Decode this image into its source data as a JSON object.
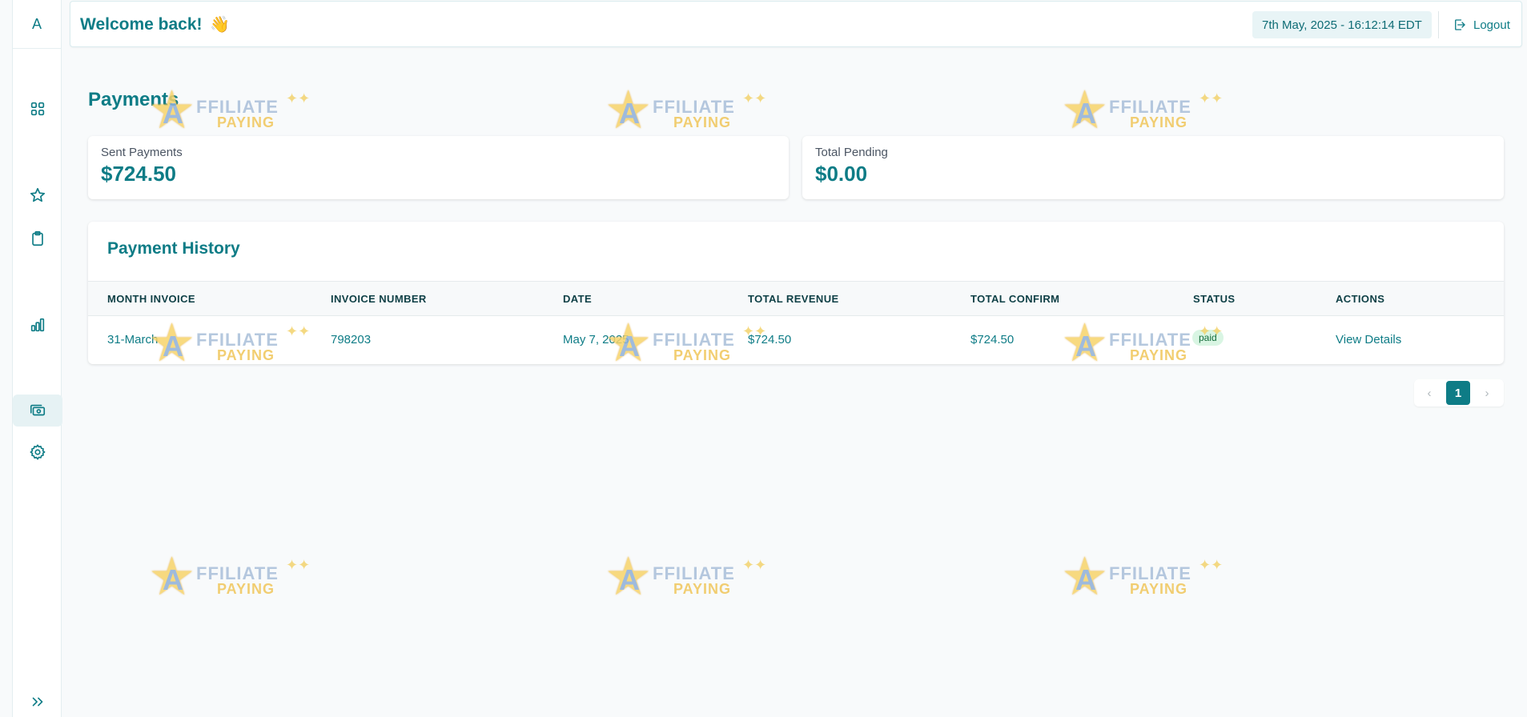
{
  "sidebar": {
    "logo_letter": "A",
    "items": [
      {
        "name": "dashboard",
        "icon": "grid-icon",
        "active": false
      },
      {
        "name": "favorites",
        "icon": "star-icon",
        "active": false
      },
      {
        "name": "clipboard",
        "icon": "clipboard-icon",
        "active": false
      },
      {
        "name": "reports",
        "icon": "bar-chart-icon",
        "active": false
      },
      {
        "name": "payments",
        "icon": "money-icon",
        "active": true
      },
      {
        "name": "settings",
        "icon": "gear-icon",
        "active": false
      },
      {
        "name": "expand",
        "icon": "double-chevron-right-icon",
        "active": false
      }
    ]
  },
  "header": {
    "welcome": "Welcome back!",
    "welcome_emoji": "👋",
    "datetime": "7th May, 2025 - 16:12:14 EDT",
    "logout_label": "Logout"
  },
  "page": {
    "title": "Payments"
  },
  "stats": {
    "sent_label": "Sent Payments",
    "sent_value": "$724.50",
    "pending_label": "Total Pending",
    "pending_value": "$0.00"
  },
  "history": {
    "title": "Payment History",
    "columns": [
      "MONTH INVOICE",
      "INVOICE NUMBER",
      "DATE",
      "TOTAL REVENUE",
      "TOTAL CONFIRM",
      "STATUS",
      "ACTIONS"
    ],
    "rows": [
      {
        "month_invoice": "31-March",
        "invoice_number": "798203",
        "date": "May 7, 2025",
        "total_revenue": "$724.50",
        "total_confirm": "$724.50",
        "status": "paid",
        "action": "View Details"
      }
    ]
  },
  "pagination": {
    "prev": "‹",
    "current_page": "1",
    "next": "›"
  },
  "watermark": {
    "letter": "A",
    "line1": "FFILIATE",
    "line2": "PAYING"
  },
  "colors": {
    "accent": "#0e7c86",
    "status_paid_bg": "#d9f5e3",
    "status_paid_text": "#146c3a"
  }
}
